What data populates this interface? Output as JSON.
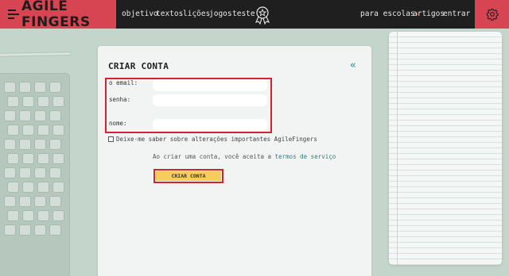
{
  "nav": {
    "logo_text": "AGILE FINGERS",
    "links": {
      "objetivo": "objetivo",
      "textos": "textos",
      "licoes": "lições",
      "jogos": "jogos",
      "teste": "teste",
      "para_escolas": "para escolas",
      "artigos": "artigos",
      "entrar": "entrar"
    },
    "badge_icon": "award-ribbon-icon",
    "settings_icon": "gear-icon"
  },
  "form": {
    "title": "CRIAR CONTA",
    "back_icon": "double-chevron-left-icon",
    "email_label": "o email:",
    "password_label": "senha:",
    "name_label": "nome:",
    "email_value": "",
    "password_value": "",
    "name_value": "",
    "newsletter_label": "Deixe-me saber sobre alterações importantes AgileFingers",
    "newsletter_checked": false,
    "terms_prefix": "Ao criar uma conta, você aceita a ",
    "terms_link": "termos de serviço",
    "submit_label": "CRIAR CONTA"
  },
  "colors": {
    "brand_red": "#d74553",
    "nav_bg": "#201f1f",
    "button_yellow": "#f6cd5a",
    "link_teal": "#2a7f7a",
    "highlight_red": "#d2232f"
  }
}
